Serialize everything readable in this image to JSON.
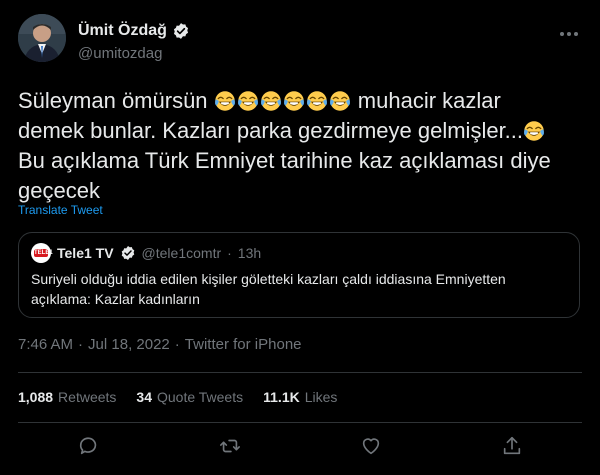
{
  "author": {
    "name": "Ümit Özdağ",
    "handle": "@umitozdag",
    "verified_icon": "verified-badge-icon",
    "avatar_icon": "profile-avatar"
  },
  "tweet": {
    "line1_a": "Süleyman ömürsün",
    "line1_b": "muhacir kazlar",
    "line2": "demek bunlar. Kazları parka gezdirmeye gelmişler...",
    "line3": "Bu açıklama Türk Emniyet tarihine kaz açıklaması diye",
    "line4": "geçecek",
    "emoji": "face-with-tears-of-joy",
    "translate_label": "Translate Tweet"
  },
  "quote": {
    "logo_text": "TELE1",
    "name": "Tele1 TV",
    "handle": "@tele1comtr",
    "dot": "·",
    "time": "13h",
    "text": "Suriyeli olduğu iddia edilen kişiler göletteki kazları çaldı iddiasına Emniyetten açıklama: Kazlar kadınların"
  },
  "meta": {
    "time": "7:46 AM",
    "sep1": "·",
    "date": "Jul 18, 2022",
    "sep2": "·",
    "source": "Twitter for iPhone"
  },
  "stats": {
    "retweets_count": "1,088",
    "retweets_label": "Retweets",
    "quotes_count": "34",
    "quotes_label": "Quote Tweets",
    "likes_count": "11.1K",
    "likes_label": "Likes"
  },
  "actions": [
    "reply-icon",
    "retweet-icon",
    "like-icon",
    "share-icon"
  ],
  "colors": {
    "background": "#000000",
    "text": "#e7e9ea",
    "muted": "#71767b",
    "accent": "#1d9bf0",
    "border": "#2f3336"
  }
}
